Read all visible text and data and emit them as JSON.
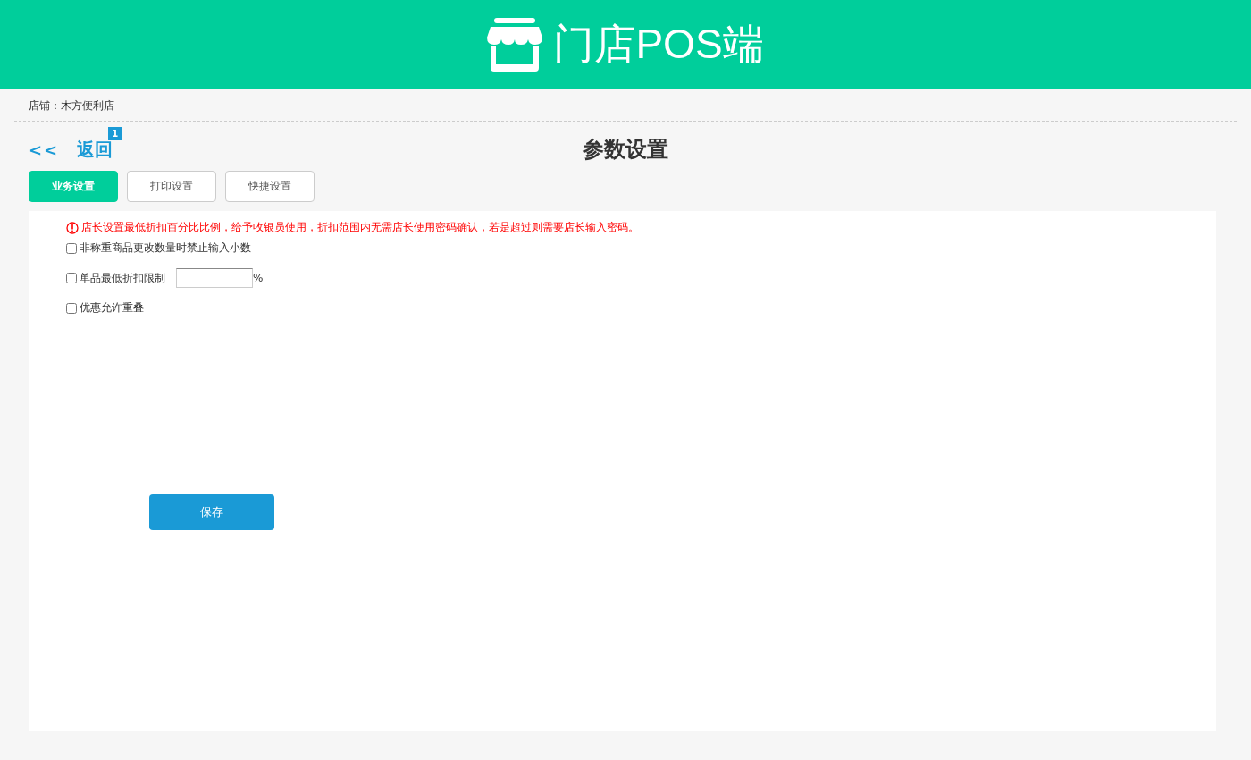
{
  "header": {
    "title": "门店POS端"
  },
  "store": {
    "label": "店铺：木方便利店"
  },
  "nav": {
    "back_arrows": "<<",
    "back": "返回",
    "badge": "1",
    "title": "参数设置"
  },
  "tabs": [
    {
      "label": "业务设置",
      "selected": true
    },
    {
      "label": "打印设置",
      "selected": false
    },
    {
      "label": "快捷设置",
      "selected": false
    }
  ],
  "notice": "店长设置最低折扣百分比比例，给予收银员使用，折扣范围内无需店长使用密码确认，若是超过则需要店长输入密码。",
  "options": [
    {
      "kind": "plain",
      "label": "非称重商品更改数量时禁止输入小数",
      "checked": false
    },
    {
      "kind": "input",
      "label": "单品最低折扣限制",
      "checked": false,
      "unit": "%"
    },
    {
      "kind": "plain",
      "label": "优惠允许重叠",
      "checked": false
    }
  ],
  "save_button": "保存"
}
